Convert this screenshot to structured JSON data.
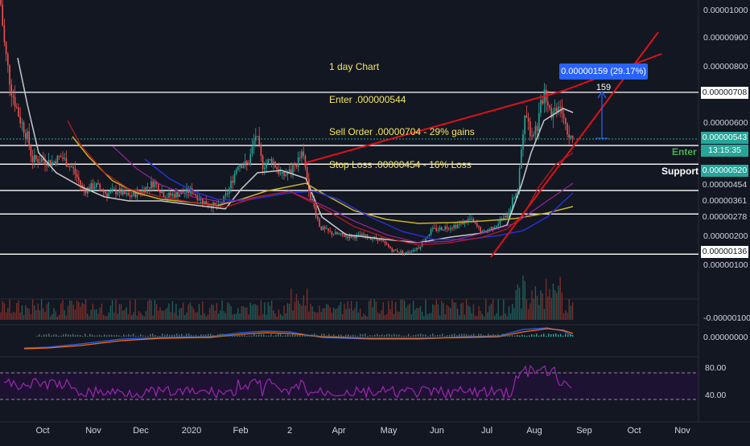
{
  "chart_data": {
    "type": "candlestick",
    "title": "",
    "annotation": [
      "1 day Chart",
      "Enter .000000544",
      "Sell Order .00000704 - 29% gains",
      "Stop Loss .00000454 - 16% Loss"
    ],
    "measure_label": "0.00000159 (29.17%) 159",
    "x_tick_labels": [
      "Oct",
      "Nov",
      "Dec",
      "2020",
      "Feb",
      "2",
      "Apr",
      "May",
      "Jun",
      "Jul",
      "Aug",
      "Sep",
      "Oct",
      "Nov"
    ],
    "price_axis_labels": [
      "0.00001000",
      "0.00000900",
      "0.00000800",
      "0.00000600",
      "0.00000200",
      "0.00000100",
      "-0.00000100",
      "0.00000000"
    ],
    "horizontal_levels": [
      7.08e-06,
      5.43e-06,
      5.2e-06,
      4.54e-06,
      3.61e-06,
      2.78e-06,
      1.36e-06
    ],
    "level_labels": {
      "l708": "0.00000708",
      "current": "0.00000543",
      "countdown": "13:15:35",
      "support": "0.00000520",
      "l454": "0.00000454",
      "l361": "0.00000361",
      "l278": "0.00000278",
      "l136": "0.00000136"
    },
    "side_labels": {
      "enter": "Enter",
      "support": "Support"
    },
    "rsi_axis_labels": [
      "80.00",
      "40.00"
    ],
    "price_series_approx": [
      [
        0,
        1.05e-05
      ],
      [
        6,
        8.6e-06
      ],
      [
        14,
        7.2e-06
      ],
      [
        24,
        6.2e-06
      ],
      [
        34,
        5.5e-06
      ],
      [
        40,
        4.7e-06
      ],
      [
        52,
        4.7e-06
      ],
      [
        64,
        4.6e-06
      ],
      [
        76,
        4.8e-06
      ],
      [
        90,
        4.4e-06
      ],
      [
        104,
        3.6e-06
      ],
      [
        118,
        3.8e-06
      ],
      [
        132,
        3.5e-06
      ],
      [
        146,
        3.6e-06
      ],
      [
        160,
        3.4e-06
      ],
      [
        176,
        3.6e-06
      ],
      [
        192,
        3.9e-06
      ],
      [
        206,
        3.4e-06
      ],
      [
        222,
        3.5e-06
      ],
      [
        238,
        3.6e-06
      ],
      [
        254,
        3.2e-06
      ],
      [
        272,
        3e-06
      ],
      [
        284,
        3.6e-06
      ],
      [
        296,
        4.6e-06
      ],
      [
        308,
        4.5e-06
      ],
      [
        318,
        5.6e-06
      ],
      [
        326,
        4.5e-06
      ],
      [
        338,
        4.7e-06
      ],
      [
        350,
        4.1e-06
      ],
      [
        362,
        4.3e-06
      ],
      [
        376,
        4.9e-06
      ],
      [
        386,
        3.4e-06
      ],
      [
        398,
        2.3e-06
      ],
      [
        412,
        2.1e-06
      ],
      [
        430,
        2e-06
      ],
      [
        450,
        2e-06
      ],
      [
        470,
        1.9e-06
      ],
      [
        488,
        1.5e-06
      ],
      [
        504,
        1.4e-06
      ],
      [
        520,
        1.6e-06
      ],
      [
        536,
        2.2e-06
      ],
      [
        552,
        2.3e-06
      ],
      [
        570,
        2.4e-06
      ],
      [
        584,
        2.6e-06
      ],
      [
        600,
        2.1e-06
      ],
      [
        616,
        2.4e-06
      ],
      [
        630,
        2.7e-06
      ],
      [
        644,
        3.8e-06
      ],
      [
        652,
        6.5e-06
      ],
      [
        660,
        5.6e-06
      ],
      [
        668,
        5.9e-06
      ],
      [
        676,
        7.2e-06
      ],
      [
        686,
        6.3e-06
      ],
      [
        696,
        6.8e-06
      ],
      [
        704,
        5.8e-06
      ],
      [
        712,
        5.4e-06
      ]
    ],
    "colors": {
      "up": "#26a69a",
      "down": "#ef5350",
      "trend": "#e0101b",
      "ma_white": "#c9c9c9",
      "ma_yellow": "#c9b227",
      "ma_blue": "#2a2fd6",
      "ma_purple": "#8e2490",
      "ma_red": "#b71c1c",
      "rsi": "#9c27b0",
      "background": "#131722",
      "measure": "#2962ff"
    }
  }
}
